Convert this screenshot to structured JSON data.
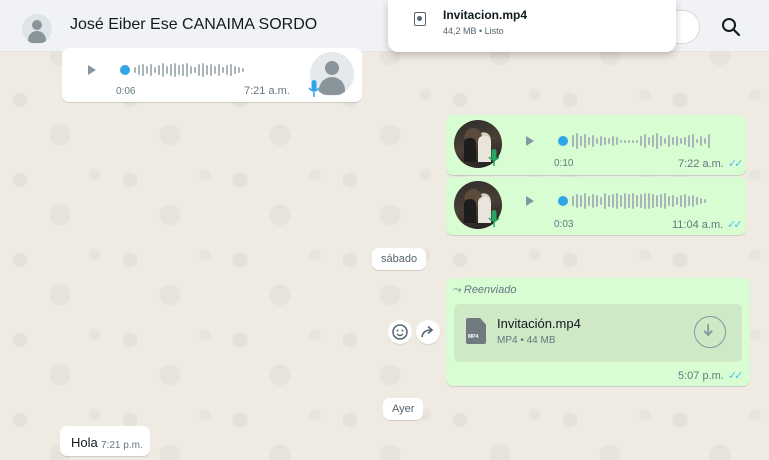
{
  "header": {
    "contact_name": "José Eiber Ese CANAIMA SORDO"
  },
  "download_popover": {
    "file_name": "Invitacion.mp4",
    "meta": "44,2 MB • Listo"
  },
  "messages": {
    "voice_in": {
      "duration": "0:06",
      "time": "7:21 a.m."
    },
    "voice_out_1": {
      "duration": "0:10",
      "time": "7:22 a.m."
    },
    "voice_out_2": {
      "duration": "0:03",
      "time": "11:04 a.m."
    },
    "date_saturday": "sábado",
    "forwarded": {
      "label": "Reenviado",
      "file_name": "Invitación.mp4",
      "file_meta": "MP4 • 44 MB",
      "file_badge": "MP4",
      "time": "5:07 p.m."
    },
    "date_yesterday": "Ayer",
    "hola": {
      "text": "Hola",
      "time": "7:21 p.m."
    }
  },
  "icons": {
    "ticks": "✓✓",
    "search": "search-icon",
    "emoji": "emoji-icon",
    "forward": "forward-icon",
    "download": "download-icon"
  },
  "colors": {
    "outgoing_bubble": "#d9fdd3",
    "incoming_bubble": "#ffffff",
    "read_ticks": "#53bdeb",
    "progress_dot": "#30a5e8",
    "chat_background": "#efeae2"
  }
}
